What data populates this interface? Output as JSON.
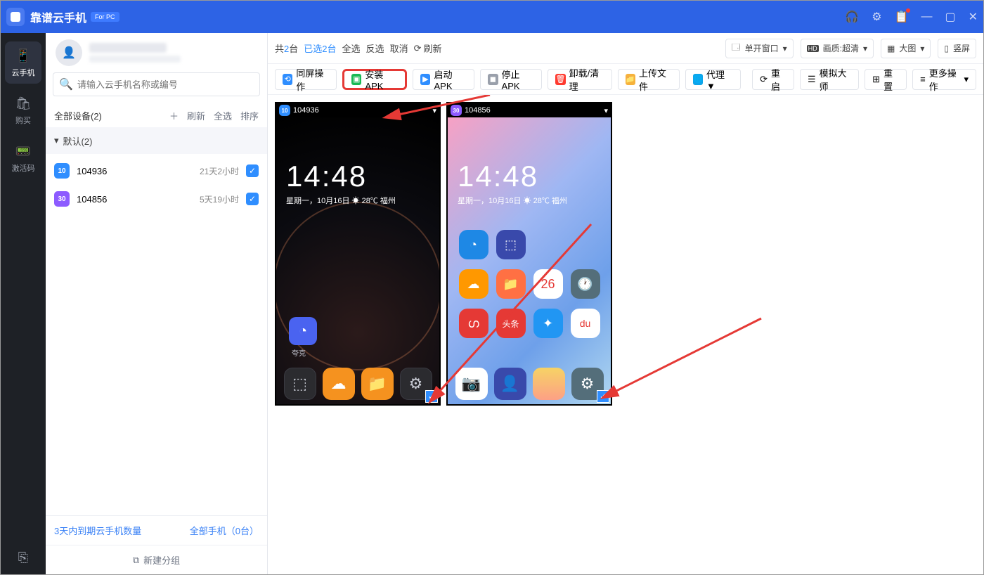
{
  "titlebar": {
    "app_name": "靠谱云手机",
    "badge": "For PC"
  },
  "rail": {
    "items": [
      {
        "label": "云手机"
      },
      {
        "label": "购买"
      },
      {
        "label": "激活码"
      }
    ]
  },
  "profile": {
    "search_placeholder": "请输入云手机名称或编号"
  },
  "group_bar": {
    "label": "全部设备(2)",
    "add": "＋",
    "links": [
      "刷新",
      "全选",
      "排序"
    ]
  },
  "group_header": {
    "label": "默认(2)"
  },
  "devices": [
    {
      "id": "104936",
      "badge": "10",
      "time": "21天2小时",
      "badge_class": "b-blue"
    },
    {
      "id": "104856",
      "badge": "30",
      "time": "5天19小时",
      "badge_class": "b-purple"
    }
  ],
  "side_foot1": {
    "left": "3天内到期云手机数量",
    "right": "全部手机（0台）"
  },
  "side_foot2": {
    "label": "新建分组"
  },
  "toolbar1": {
    "total_prefix": "共",
    "total_count": "2",
    "total_suffix": "台",
    "sel_prefix": "已选",
    "sel_count": "2",
    "sel_suffix": "台",
    "select_all": "全选",
    "invert": "反选",
    "cancel": "取消",
    "refresh": "刷新",
    "window_mode": "单开窗口",
    "quality": "画质:超清",
    "size": "大图",
    "orient": "竖屏"
  },
  "toolbar2": {
    "sync": "同屏操作",
    "install": "安装APK",
    "launch": "启动APK",
    "stop": "停止APK",
    "uninstall": "卸载/清理",
    "upload": "上传文件",
    "proxy": "代理 ▼",
    "restart": "重启",
    "master": "模拟大师",
    "reset": "重置",
    "more": "更多操作"
  },
  "phone1": {
    "id": "104936",
    "badge": "10",
    "time": "14:48",
    "date": "星期一，10月16日 ☀ 28℃ 福州",
    "qk": "夸克"
  },
  "phone2": {
    "id": "104856",
    "badge": "30",
    "time": "14:48",
    "date": "星期一，10月16日 ☀ 28℃ 福州"
  }
}
